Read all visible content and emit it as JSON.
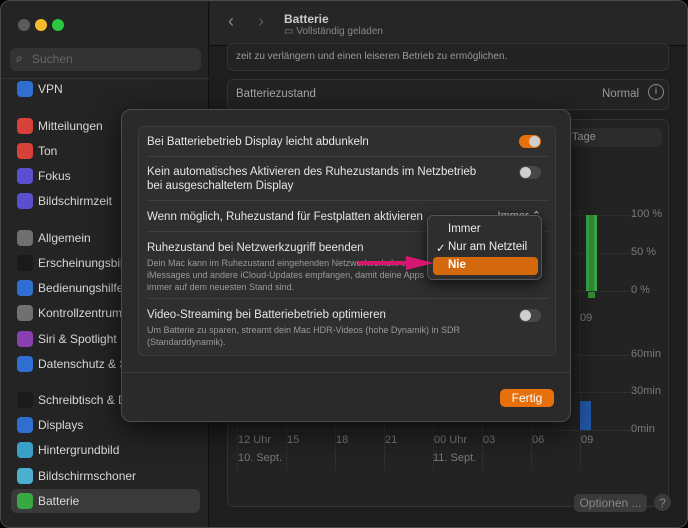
{
  "window": {
    "colors": {
      "close": "#5b5b5b",
      "minimize": "#f5bc2e",
      "zoom": "#29c840"
    }
  },
  "sidebar": {
    "search_placeholder": "Suchen",
    "items": [
      {
        "label": "VPN",
        "icon": "globe-icon",
        "color": "#2f6fd1"
      },
      {
        "label": "Mitteilungen",
        "icon": "bell-icon",
        "color": "#d8403a"
      },
      {
        "label": "Ton",
        "icon": "speaker-icon",
        "color": "#d8403a"
      },
      {
        "label": "Fokus",
        "icon": "moon-icon",
        "color": "#5a4fcf"
      },
      {
        "label": "Bildschirmzeit",
        "icon": "hourglass-icon",
        "color": "#5a4fcf"
      },
      {
        "label": "Allgemein",
        "icon": "gear-icon",
        "color": "#707070"
      },
      {
        "label": "Erscheinungsbild",
        "icon": "appearance-icon",
        "color": "#1a1a1a"
      },
      {
        "label": "Bedienungshilfen",
        "icon": "accessibility-icon",
        "color": "#2f6fd1"
      },
      {
        "label": "Kontrollzentrum",
        "icon": "toggles-icon",
        "color": "#707070"
      },
      {
        "label": "Siri & Spotlight",
        "icon": "siri-icon",
        "color": "#8a3fb0"
      },
      {
        "label": "Datenschutz & Sicherheit",
        "icon": "hand-icon",
        "color": "#2f6fd1"
      },
      {
        "label": "Schreibtisch & Dock",
        "icon": "dock-icon",
        "color": "#1a1a1a"
      },
      {
        "label": "Displays",
        "icon": "sun-icon",
        "color": "#2f6fd1"
      },
      {
        "label": "Hintergrundbild",
        "icon": "flower-icon",
        "color": "#3aa0c8"
      },
      {
        "label": "Bildschirmschoner",
        "icon": "screensaver-icon",
        "color": "#4bb0d0"
      },
      {
        "label": "Batterie",
        "icon": "battery-icon",
        "color": "#38a843",
        "selected": true
      }
    ]
  },
  "header": {
    "title": "Batterie",
    "subtitle": "Vollständig geladen"
  },
  "main": {
    "intro_text": "zeit zu verlängern und einen leiseren Betrieb zu ermöglichen.",
    "health_label": "Batteriezustand",
    "health_value": "Normal",
    "segment_label": "Tage",
    "level_ticks": [
      "100 %",
      "50 %",
      "0 %"
    ],
    "usage_ticks": [
      "60min",
      "30min",
      "0min"
    ],
    "level_x_label": "09",
    "x_ticks": [
      "12 Uhr",
      "15",
      "18",
      "21",
      "00 Uhr",
      "03",
      "06",
      "09"
    ],
    "dates": [
      "10. Sept.",
      "11. Sept."
    ],
    "options_button": "Optionen ...",
    "help_button": "?",
    "bar_colors": {
      "level": "#2f8f38",
      "usage": "#2357a8"
    },
    "level_percent": 100,
    "usage_minutes": 23
  },
  "dialog": {
    "rows": [
      {
        "title": "Bei Batteriebetrieb Display leicht abdunkeln",
        "toggle": true
      },
      {
        "title": "Kein automatisches Aktivieren des Ruhezustands im Netzbetrieb bei ausgeschaltetem Display",
        "toggle": false
      },
      {
        "title": "Wenn möglich, Ruhezustand für Festplatten aktivieren",
        "popup_value": "Immer"
      },
      {
        "title": "Ruhezustand bei Netzwerkzugriff beenden",
        "description": "Dein Mac kann im Ruhezustand eingehenden Netzwerkverkehr wie iMessages und andere iCloud-Updates empfangen, damit deine Apps immer auf dem neuesten Stand sind."
      },
      {
        "title": "Video-Streaming bei Batteriebetrieb optimieren",
        "description": "Um Batterie zu sparen, streamt dein Mac HDR-Videos (hohe Dynamik) in SDR (Standarddynamik).",
        "toggle": false
      }
    ],
    "done_button": "Fertig",
    "accent": "#e8700c"
  },
  "popup_menu": {
    "items": [
      {
        "label": "Immer",
        "checked": false
      },
      {
        "label": "Nur am Netzteil",
        "checked": true
      },
      {
        "label": "Nie",
        "highlighted": true
      }
    ],
    "check_glyph": "✓"
  },
  "annotation": {
    "arrow_color": "#d6166f"
  }
}
